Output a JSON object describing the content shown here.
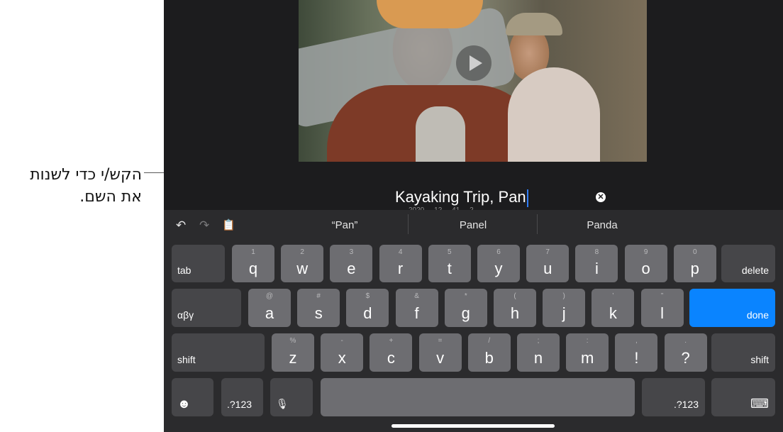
{
  "callout": {
    "line1": "הקש/י כדי לשנות",
    "line2": "את השם."
  },
  "project": {
    "title": "Kayaking Trip, Pan",
    "subtitle": "2020 ... 12 ... 41 ... 2"
  },
  "toolbar": {
    "undo": "↶",
    "redo": "↷",
    "paste": "📋"
  },
  "suggestions": [
    "“Pan”",
    "Panel",
    "Panda"
  ],
  "keyboard": {
    "row1": [
      {
        "main": "q",
        "alt": "1"
      },
      {
        "main": "w",
        "alt": "2"
      },
      {
        "main": "e",
        "alt": "3"
      },
      {
        "main": "r",
        "alt": "4"
      },
      {
        "main": "t",
        "alt": "5"
      },
      {
        "main": "y",
        "alt": "6"
      },
      {
        "main": "u",
        "alt": "7"
      },
      {
        "main": "i",
        "alt": "8"
      },
      {
        "main": "o",
        "alt": "9"
      },
      {
        "main": "p",
        "alt": "0"
      }
    ],
    "row2": [
      {
        "main": "a",
        "alt": "@"
      },
      {
        "main": "s",
        "alt": "#"
      },
      {
        "main": "d",
        "alt": "$"
      },
      {
        "main": "f",
        "alt": "&"
      },
      {
        "main": "g",
        "alt": "*"
      },
      {
        "main": "h",
        "alt": "("
      },
      {
        "main": "j",
        "alt": ")"
      },
      {
        "main": "k",
        "alt": "’"
      },
      {
        "main": "l",
        "alt": "”"
      }
    ],
    "row3": [
      {
        "main": "z",
        "alt": "%"
      },
      {
        "main": "x",
        "alt": "-"
      },
      {
        "main": "c",
        "alt": "+"
      },
      {
        "main": "v",
        "alt": "="
      },
      {
        "main": "b",
        "alt": "/"
      },
      {
        "main": "n",
        "alt": ";"
      },
      {
        "main": "m",
        "alt": ":"
      },
      {
        "main": "!",
        "alt": ","
      },
      {
        "main": "?",
        "alt": "."
      }
    ],
    "tab": "tab",
    "delete": "delete",
    "greek": "αβγ",
    "done": "done",
    "shift_left": "shift",
    "shift_right": "shift",
    "numbers_left": ".?123",
    "numbers_right": ".?123",
    "emoji_icon": "☻",
    "mic_icon": "🎙",
    "hide_icon": "⌨"
  }
}
